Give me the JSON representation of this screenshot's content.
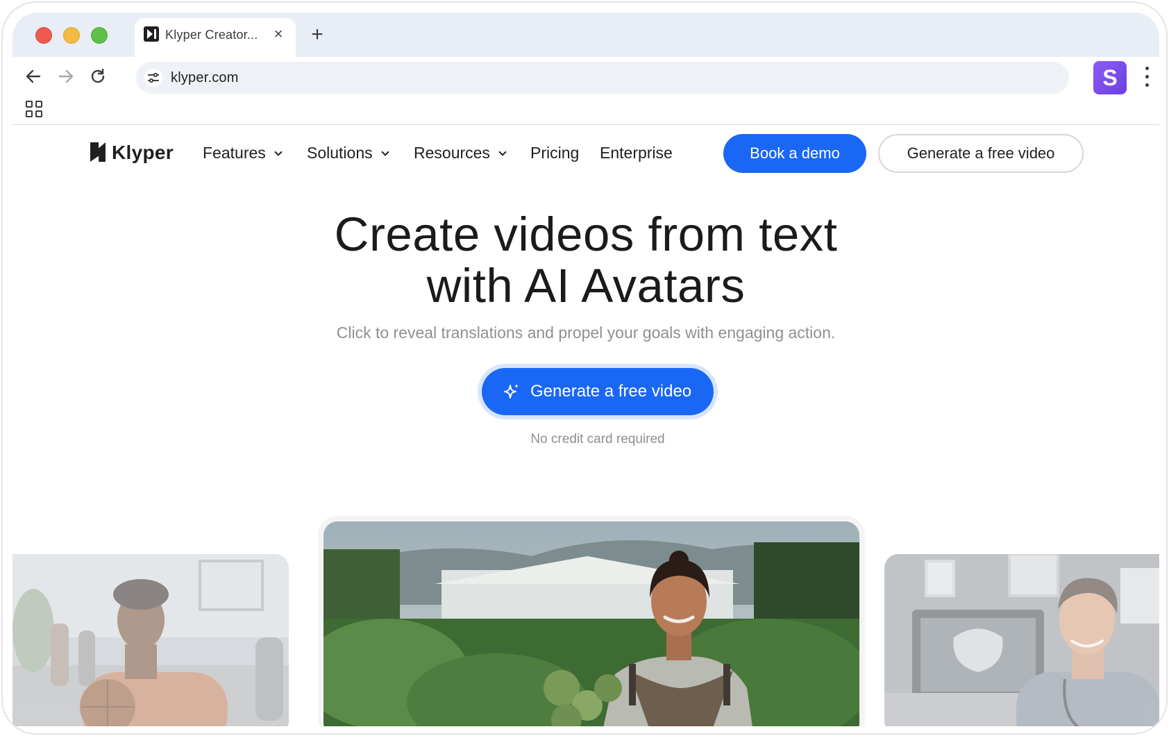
{
  "browser": {
    "tab": {
      "title": "Klyper Creator..."
    },
    "url": "klyper.com",
    "profile_initial": "S",
    "colors": {
      "tabstrip": "#e9eef6",
      "profile": "#7c4ff0"
    }
  },
  "site": {
    "logo": "Klyper",
    "nav": [
      {
        "label": "Features",
        "has_dropdown": true
      },
      {
        "label": "Solutions",
        "has_dropdown": true
      },
      {
        "label": "Resources",
        "has_dropdown": true
      },
      {
        "label": "Pricing",
        "has_dropdown": false
      },
      {
        "label": "Enterprise",
        "has_dropdown": false
      }
    ],
    "book_demo": "Book a demo",
    "generate_top": "Generate a free video",
    "accent": "#1a67f5"
  },
  "hero": {
    "title_line1": "Create videos from text",
    "title_line2": "with AI Avatars",
    "subtitle": "Click to reveal translations and propel your goals with engaging action.",
    "cta": "Generate a free video",
    "note": "No credit card required"
  },
  "avatars": [
    {
      "icon": "basketball-player-avatar-image"
    },
    {
      "icon": "farmer-avatar-image"
    },
    {
      "icon": "doctor-avatar-image"
    }
  ]
}
